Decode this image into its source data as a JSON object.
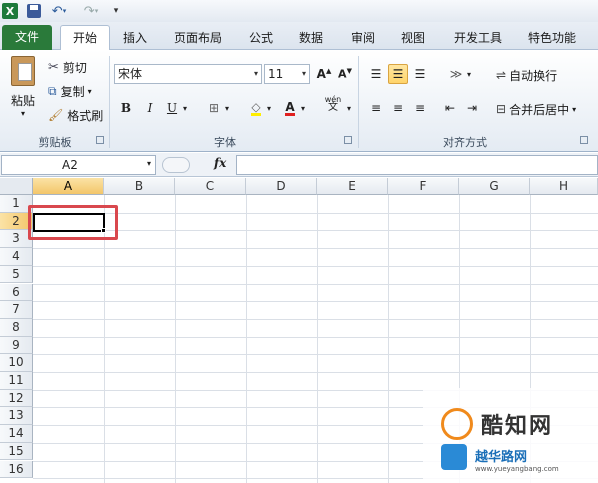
{
  "qat": {
    "logo": "X"
  },
  "tabs": [
    {
      "label": "文件"
    },
    {
      "label": "开始"
    },
    {
      "label": "插入"
    },
    {
      "label": "页面布局"
    },
    {
      "label": "公式"
    },
    {
      "label": "数据"
    },
    {
      "label": "审阅"
    },
    {
      "label": "视图"
    },
    {
      "label": "开发工具"
    },
    {
      "label": "特色功能"
    }
  ],
  "ribbon": {
    "clipboard": {
      "paste_label": "粘贴",
      "cut_label": "剪切",
      "copy_label": "复制",
      "format_painter_label": "格式刷",
      "group_label": "剪贴板"
    },
    "font": {
      "font_name": "宋体",
      "font_size": "11",
      "bold": "B",
      "italic": "I",
      "underline": "U",
      "font_color_glyph": "A",
      "phonetic_glyph": "wén",
      "group_label": "字体"
    },
    "alignment": {
      "wrap_text_label": "自动换行",
      "merge_center_label": "合并后居中",
      "group_label": "对齐方式"
    }
  },
  "formula_bar": {
    "name_box": "A2",
    "fx": "fx",
    "value": ""
  },
  "grid": {
    "columns": [
      "A",
      "B",
      "C",
      "D",
      "E",
      "F",
      "G",
      "H"
    ],
    "rows": [
      "1",
      "2",
      "3",
      "4",
      "5",
      "6",
      "7",
      "8",
      "9",
      "10",
      "11",
      "12",
      "13",
      "14",
      "15",
      "16"
    ],
    "active_cell": "A2"
  },
  "watermark": {
    "brand1": "酷知网",
    "brand2": "越华路网",
    "url": "www.yueyangbang.com"
  },
  "colors": {
    "file_tab": "#2a7a3a",
    "highlight": "#d9484e",
    "active_header": "#f3c66a"
  }
}
